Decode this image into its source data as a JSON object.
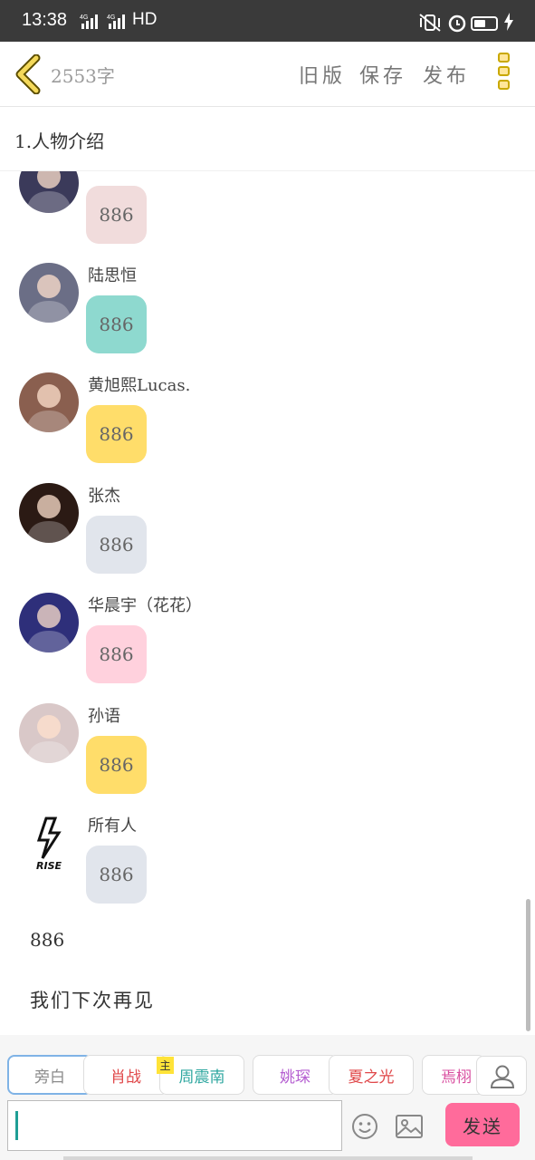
{
  "status_bar": {
    "time": "13:38",
    "net_label_1": "4G",
    "net_label_2": "4G",
    "hd_label": "HD",
    "battery_percent": 55
  },
  "header": {
    "word_count": "2553字",
    "old_version": "旧版",
    "save": "保存",
    "publish": "发布"
  },
  "chapter_title": "1.人物介绍",
  "messages": [
    {
      "sender": "",
      "text": "886",
      "bubble_color": "#f1dcdc",
      "avatar_color": "#3b3a5a"
    },
    {
      "sender": "陆思恒",
      "text": "886",
      "bubble_color": "#8ed9cf",
      "avatar_color": "#6b6e86"
    },
    {
      "sender": "黄旭熙Lucas.",
      "text": "886",
      "bubble_color": "#ffdd6a",
      "avatar_color": "#8a5f4f"
    },
    {
      "sender": "张杰",
      "text": "886",
      "bubble_color": "#e1e5ec",
      "avatar_color": "#2b1a14"
    },
    {
      "sender": "华晨宇（花花）",
      "text": "886",
      "bubble_color": "#ffd1dd",
      "avatar_color": "#2e2f7a"
    },
    {
      "sender": "孙语",
      "text": "886",
      "bubble_color": "#ffdd6a",
      "avatar_color": "#d9c8c8"
    },
    {
      "sender": "所有人",
      "text": "886",
      "bubble_color": "#e1e5ec",
      "avatar_color": "#ffffff",
      "avatar_text": "RISE"
    }
  ],
  "plain_lines": [
    "886",
    "我们下次再见"
  ],
  "characters": [
    {
      "name": "旁白",
      "color": "#8a8a8a"
    },
    {
      "name": "肖战",
      "color": "#e0484a"
    },
    {
      "name": "周震南",
      "color": "#2fa7a0",
      "main_badge": "主"
    },
    {
      "name": "姚琛",
      "color": "#b55fd1"
    },
    {
      "name": "夏之光",
      "color": "#e0484a"
    },
    {
      "name": "焉栩",
      "color": "#d94fa0"
    }
  ],
  "input": {
    "placeholder": "",
    "value": ""
  },
  "send_label": "发送",
  "icons": {
    "back": "chevron-left-icon",
    "menu": "more-icon",
    "user": "user-icon",
    "emoji": "emoji-icon",
    "image": "image-icon"
  }
}
